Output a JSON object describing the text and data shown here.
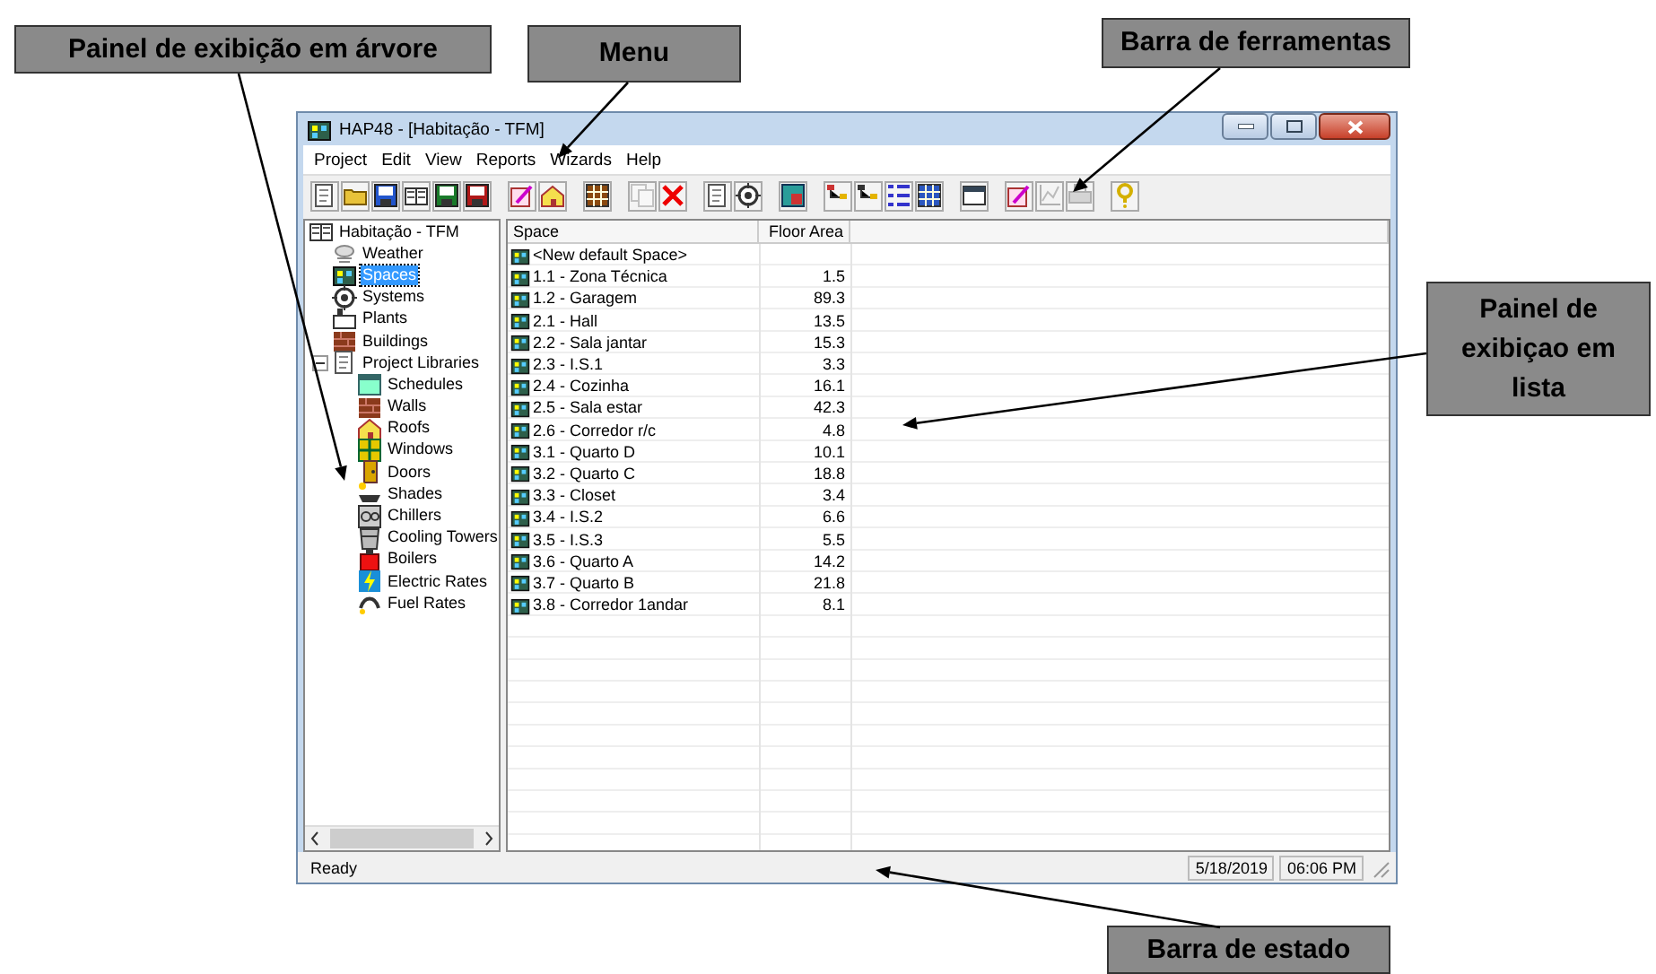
{
  "window": {
    "title": "HAP48 - [Habitação - TFM]"
  },
  "menu": [
    "Project",
    "Edit",
    "View",
    "Reports",
    "Wizards",
    "Help"
  ],
  "toolbar_groups": [
    [
      {
        "disabled": false
      },
      {
        "disabled": false
      },
      {
        "disabled": false
      },
      {
        "disabled": false
      },
      {
        "disabled": false
      },
      {
        "disabled": false
      }
    ],
    [
      {
        "disabled": false
      },
      {
        "disabled": false
      }
    ],
    [
      {
        "disabled": false
      }
    ],
    [
      {
        "disabled": true
      },
      {
        "disabled": false
      }
    ],
    [
      {
        "disabled": false
      },
      {
        "disabled": false
      }
    ],
    [
      {
        "disabled": false
      }
    ],
    [
      {
        "disabled": false
      },
      {
        "disabled": false
      },
      {
        "disabled": false
      },
      {
        "disabled": false
      }
    ],
    [
      {
        "disabled": false
      }
    ],
    [
      {
        "disabled": false
      },
      {
        "disabled": true
      },
      {
        "disabled": true
      }
    ],
    [
      {
        "disabled": false
      }
    ]
  ],
  "tree": {
    "label": "Habitação - TFM",
    "selected": false,
    "children": [
      {
        "label": "Weather",
        "selected": false
      },
      {
        "label": "Spaces",
        "selected": true
      },
      {
        "label": "Systems",
        "selected": false
      },
      {
        "label": "Plants",
        "selected": false
      },
      {
        "label": "Buildings",
        "selected": false
      },
      {
        "label": "Project Libraries",
        "selected": false,
        "expanded": true,
        "children": [
          {
            "label": "Schedules",
            "selected": false
          },
          {
            "label": "Walls",
            "selected": false
          },
          {
            "label": "Roofs",
            "selected": false
          },
          {
            "label": "Windows",
            "selected": false
          },
          {
            "label": "Doors",
            "selected": false
          },
          {
            "label": "Shades",
            "selected": false
          },
          {
            "label": "Chillers",
            "selected": false
          },
          {
            "label": "Cooling Towers",
            "selected": false
          },
          {
            "label": "Boilers",
            "selected": false
          },
          {
            "label": "Electric Rates",
            "selected": false
          },
          {
            "label": "Fuel Rates",
            "selected": false
          }
        ]
      }
    ]
  },
  "list": {
    "columns": [
      "Space",
      "Floor Area"
    ],
    "rows": [
      {
        "space": "<New default Space>"
      },
      {
        "space": "1.1 - Zona Técnica",
        "floor_area": "1.5"
      },
      {
        "space": "1.2 - Garagem",
        "floor_area": "89.3"
      },
      {
        "space": "2.1 - Hall",
        "floor_area": "13.5"
      },
      {
        "space": "2.2 - Sala jantar",
        "floor_area": "15.3"
      },
      {
        "space": "2.3 - I.S.1",
        "floor_area": "3.3"
      },
      {
        "space": "2.4 - Cozinha",
        "floor_area": "16.1"
      },
      {
        "space": "2.5 - Sala estar",
        "floor_area": "42.3"
      },
      {
        "space": "2.6 - Corredor r/c",
        "floor_area": "4.8"
      },
      {
        "space": "3.1 - Quarto D",
        "floor_area": "10.1"
      },
      {
        "space": "3.2 - Quarto C",
        "floor_area": "18.8"
      },
      {
        "space": "3.3 - Closet",
        "floor_area": "3.4"
      },
      {
        "space": "3.4 - I.S.2",
        "floor_area": "6.6"
      },
      {
        "space": "3.5 - I.S.3",
        "floor_area": "5.5"
      },
      {
        "space": "3.6 - Quarto A",
        "floor_area": "14.2"
      },
      {
        "space": "3.7 - Quarto B",
        "floor_area": "21.8"
      },
      {
        "space": "3.8 - Corredor 1andar",
        "floor_area": "8.1"
      }
    ]
  },
  "status_bar": {
    "message": "Ready",
    "date": "5/18/2019",
    "time": "06:06 PM"
  },
  "callouts": [
    {
      "text": "Painel de exibição em árvore"
    },
    {
      "text": "Menu"
    },
    {
      "text": "Barra de ferramentas"
    },
    {
      "text": "Painel de exibiçao em lista"
    },
    {
      "text": "Barra de estado"
    }
  ]
}
